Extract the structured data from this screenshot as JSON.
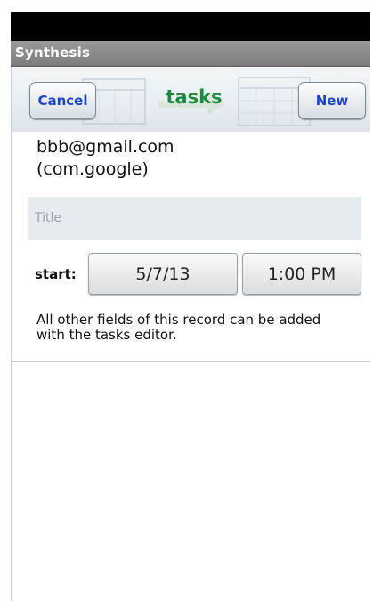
{
  "window": {
    "app_title": "Synthesis"
  },
  "header": {
    "title": "tasks",
    "cancel_label": "Cancel",
    "new_label": "New"
  },
  "account": {
    "email": "bbb@gmail.com",
    "type": "(com.google)"
  },
  "form": {
    "title_placeholder": "Title",
    "title_value": "",
    "start_label": "start:",
    "start_date": "5/7/13",
    "start_time": "1:00 PM"
  },
  "info": {
    "text": "All other fields of this record can be added with the tasks editor."
  },
  "colors": {
    "title_bar": "#8a8a8a",
    "header_title": "#1a8a3c",
    "nav_button_text": "#1c44c8",
    "input_background": "#e6ebef"
  }
}
